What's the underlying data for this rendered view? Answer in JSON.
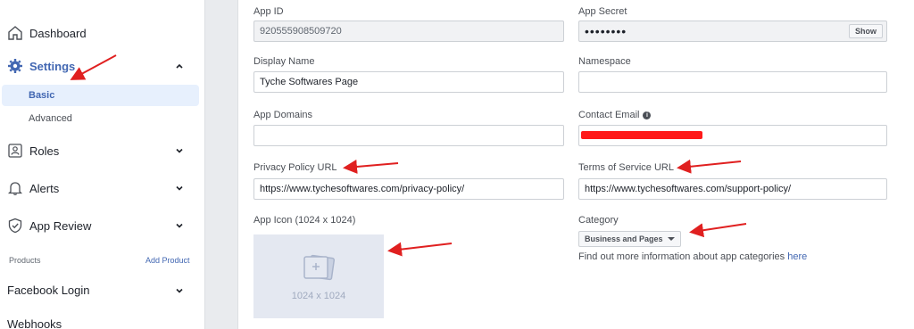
{
  "sidebar": {
    "dashboard": "Dashboard",
    "settings": "Settings",
    "basic": "Basic",
    "advanced": "Advanced",
    "roles": "Roles",
    "alerts": "Alerts",
    "app_review": "App Review",
    "products_label": "Products",
    "add_product": "Add Product",
    "facebook_login": "Facebook Login",
    "webhooks": "Webhooks"
  },
  "form": {
    "app_id_label": "App ID",
    "app_id_value": "920555908509720",
    "app_secret_label": "App Secret",
    "app_secret_value": "••••••••",
    "show_button": "Show",
    "display_name_label": "Display Name",
    "display_name_value": "Tyche Softwares Page",
    "namespace_label": "Namespace",
    "namespace_value": "",
    "app_domains_label": "App Domains",
    "app_domains_value": "",
    "contact_email_label": "Contact Email",
    "privacy_label": "Privacy Policy URL",
    "privacy_value": "https://www.tychesoftwares.com/privacy-policy/",
    "tos_label": "Terms of Service URL",
    "tos_value": "https://www.tychesoftwares.com/support-policy/",
    "app_icon_label": "App Icon (1024 x 1024)",
    "app_icon_size": "1024 x 1024",
    "category_label": "Category",
    "category_value": "Business and Pages",
    "category_help": "Find out more information about app categories",
    "category_help_link": "here"
  },
  "colors": {
    "accent": "#4267b2",
    "annotation": "#e02020"
  }
}
